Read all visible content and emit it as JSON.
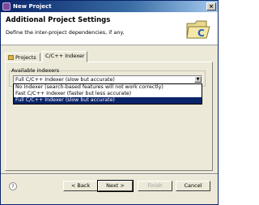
{
  "window": {
    "title": "New Project"
  },
  "banner": {
    "heading": "Additional Project Settings",
    "subheading": "Define the inter-project dependencies, if any."
  },
  "tabs": [
    {
      "label": "Projects",
      "icon": "folder-icon"
    },
    {
      "label": "C/C++ Indexer",
      "active": true
    }
  ],
  "indexer": {
    "group_label": "Available indexers",
    "selected_value": "Full C/C++ Indexer (slow but accurate)",
    "options": [
      "No Indexer (search-based features will not work correctly)",
      "Fast C/C++ Indexer (faster but less accurate)",
      "Full C/C++ Indexer (slow but accurate)"
    ],
    "highlighted_index": 2
  },
  "buttons": {
    "help": "?",
    "back": "< Back",
    "next": "Next >",
    "finish": "Finish",
    "cancel": "Cancel"
  },
  "colors": {
    "title_bar": "#0a246a",
    "dialog_bg": "#ece9d8",
    "selection": "#0a246a"
  }
}
